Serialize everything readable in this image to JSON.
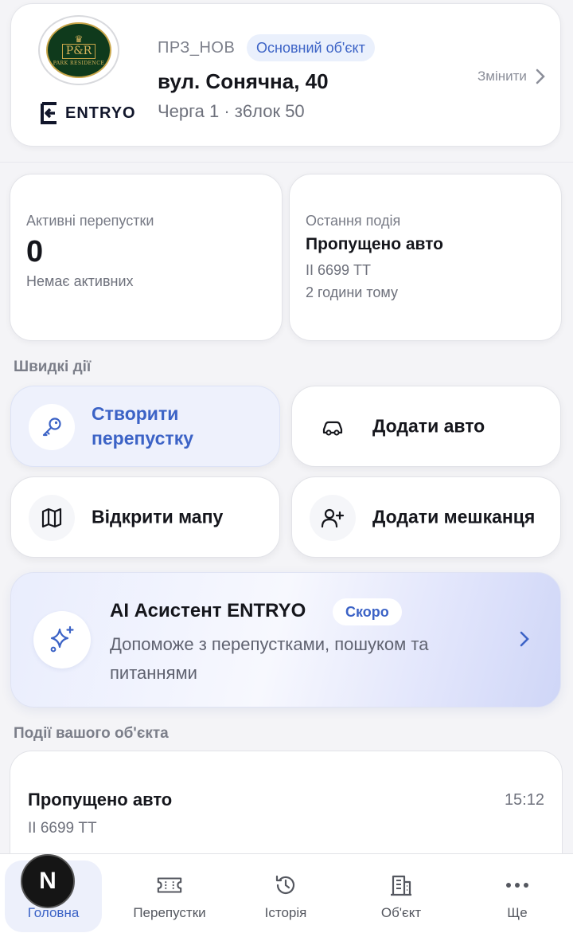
{
  "object_card": {
    "logo_monogram": "P&R",
    "logo_text": "PARK RESIDENCE",
    "brand_name": "ENTRYO",
    "code": "ПРЗ_НОВ",
    "badge": "Основний об'єкт",
    "address": "вул. Сонячна, 40",
    "queue": "Черга 1 · з6лок 50",
    "change_label": "Змінити"
  },
  "stats": {
    "active_passes": {
      "label": "Активні перепустки",
      "value": "0",
      "sub": "Немає активних"
    },
    "last_event": {
      "label": "Остання подія",
      "title": "Пропущено авто",
      "plate": "ІІ 6699 ТТ",
      "time": "2 години тому"
    }
  },
  "quick_actions": {
    "title": "Швидкі дії",
    "create_pass": "Створити перепустку",
    "add_car": "Додати авто",
    "open_map": "Відкрити мапу",
    "add_resident": "Додати мешканця"
  },
  "ai": {
    "title": "AI Асистент ENTRYO",
    "badge": "Скоро",
    "description": "Допоможе з перепустками, пошуком та питаннями"
  },
  "events": {
    "title": "Події вашого об'єкта",
    "items": [
      {
        "title": "Пропущено авто",
        "plate": "ІІ 6699 ТТ",
        "time": "15:12"
      }
    ]
  },
  "tabs": {
    "home": "Головна",
    "passes": "Перепустки",
    "history": "Історія",
    "object": "Об'єкт",
    "more": "Ще"
  },
  "dev_badge": "N",
  "colors": {
    "accent": "#3c63c6",
    "background": "#f4f4f7",
    "primary_action_bg": "#eef1fc",
    "logo_green": "#0f3a1c",
    "logo_gold": "#c9a64a"
  },
  "icons": {
    "create_pass": "key-icon",
    "add_car": "car-icon",
    "open_map": "map-icon",
    "add_resident": "user-plus-icon",
    "ai": "sparkles-icon",
    "tab_home": "home-icon",
    "tab_passes": "ticket-icon",
    "tab_history": "history-icon",
    "tab_object": "building-icon",
    "tab_more": "more-icon"
  }
}
